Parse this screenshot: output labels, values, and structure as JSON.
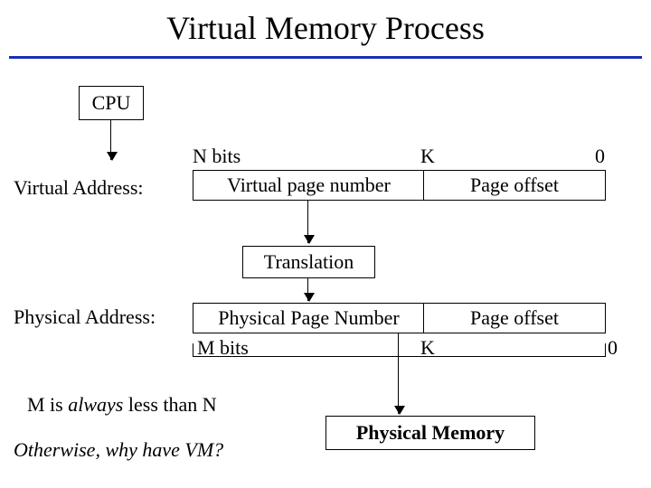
{
  "title": "Virtual Memory Process",
  "cpu": "CPU",
  "va_label": "Virtual Address:",
  "pa_label": "Physical Address:",
  "n_bits": "N bits",
  "k_top": "K",
  "zero_top": "0",
  "vpn": "Virtual page number",
  "po": "Page offset",
  "translation": "Translation",
  "ppn": "Physical Page Number",
  "po2": "Page offset",
  "m_bits": "M bits",
  "k_bot": "K",
  "zero_bot": "0",
  "note1_a": "M is ",
  "note1_b": "always",
  "note1_c": " less than N",
  "note2": "Otherwise, why have VM?",
  "phys_mem": "Physical Memory"
}
